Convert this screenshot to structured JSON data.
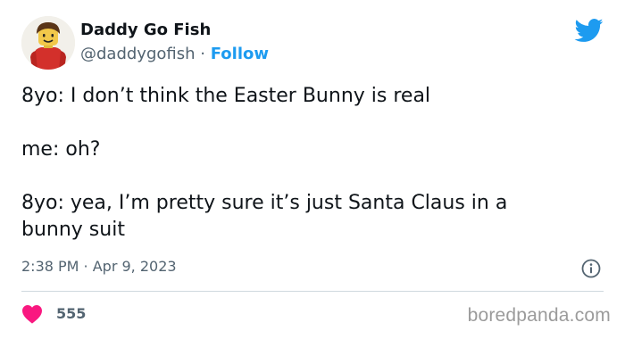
{
  "author": {
    "display_name": "Daddy Go Fish",
    "handle": "@daddygofish",
    "separator": "·",
    "follow_label": "Follow",
    "avatar_icon": "lego-figure-avatar"
  },
  "brand": {
    "logo_icon": "twitter-bird-icon",
    "accent_color": "#1d9bf0"
  },
  "tweet": {
    "text": "8yo: I don’t think the Easter Bunny is real\n\nme: oh?\n\n8yo: yea, I’m pretty sure it’s just Santa Claus in a\nbunny suit",
    "timestamp": "2:38 PM · Apr 9, 2023",
    "info_icon": "info-icon"
  },
  "engagement": {
    "like_icon": "heart-icon",
    "like_color": "#f91880",
    "like_count": "555"
  },
  "watermark": {
    "text": "boredpanda.com"
  }
}
